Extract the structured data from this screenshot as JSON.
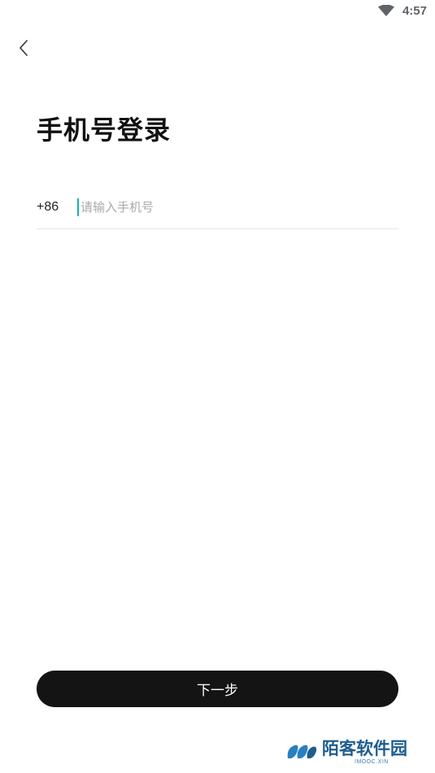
{
  "status_bar": {
    "time": "4:57",
    "wifi_icon": "wifi-icon"
  },
  "header": {
    "back_icon": "chevron-left-icon"
  },
  "main": {
    "title": "手机号登录",
    "country_code": "+86",
    "phone_placeholder": "请输入手机号",
    "phone_value": ""
  },
  "footer": {
    "next_label": "下一步"
  },
  "watermark": {
    "text": "陌客软件园",
    "sub": "IMOOC.XIN"
  },
  "colors": {
    "accent": "#19b4a6",
    "button_bg": "#141414",
    "watermark": "#1d5d8f"
  }
}
